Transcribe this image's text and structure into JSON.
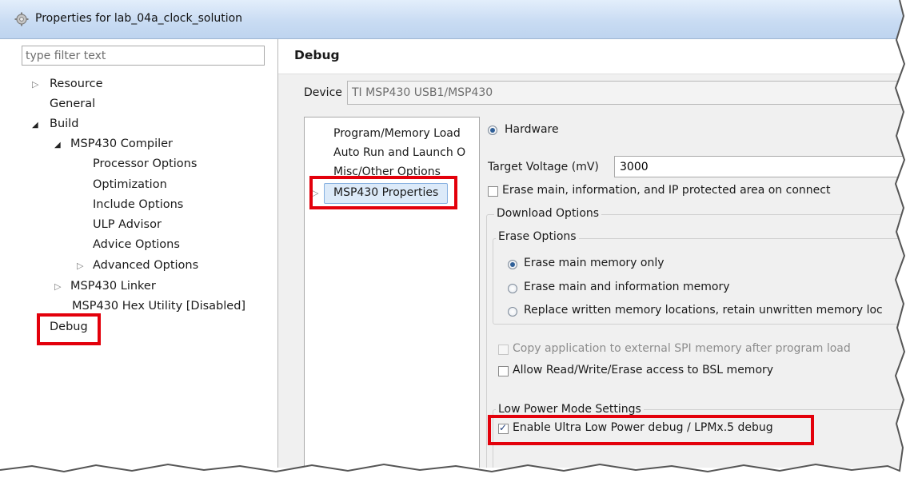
{
  "window": {
    "title": "Properties for lab_04a_clock_solution"
  },
  "left_pane": {
    "filter_placeholder": "type filter text",
    "tree": {
      "resource": "Resource",
      "general": "General",
      "build": "Build",
      "compiler": "MSP430 Compiler",
      "processor_options": "Processor Options",
      "optimization": "Optimization",
      "include_options": "Include Options",
      "ulp_advisor": "ULP Advisor",
      "advice_options": "Advice Options",
      "advanced_options": "Advanced Options",
      "linker": "MSP430 Linker",
      "hex_utility": "MSP430 Hex Utility  [Disabled]",
      "debug": "Debug"
    }
  },
  "right_pane": {
    "heading": "Debug",
    "device_label": "Device",
    "device_value": "TI MSP430 USB1/MSP430",
    "categories": {
      "program_memory_load": "Program/Memory Load",
      "auto_run": "Auto Run and Launch O",
      "misc_other": "Misc/Other Options",
      "msp430_properties": "MSP430 Properties"
    },
    "settings": {
      "hardware": "Hardware",
      "target_voltage_label": "Target Voltage (mV)",
      "target_voltage_value": "3000",
      "erase_on_connect": "Erase main, information, and IP protected area on connect",
      "download_options": "Download Options",
      "erase_options": "Erase Options",
      "erase_main_only": "Erase main memory only",
      "erase_main_info": "Erase main and information memory",
      "replace_written": "Replace written memory locations, retain unwritten memory loc",
      "copy_spi": "Copy application to external SPI memory after program load",
      "allow_bsl": "Allow Read/Write/Erase access to BSL memory",
      "low_power_title": "Low Power Mode Settings",
      "enable_ulp_debug": "Enable Ultra Low Power debug / LPMx.5 debug"
    },
    "states": {
      "hardware_selected": true,
      "erase_on_connect": false,
      "erase_mode": "main_only",
      "copy_spi": false,
      "allow_bsl": false,
      "enable_ulp_debug": true
    }
  },
  "colors": {
    "highlight_box": "#e3000b",
    "title_bar": "#c9dcf3",
    "selection": "#dceaf9"
  },
  "icons": {
    "window": "gear-icon",
    "collapsed": "triangle-right-icon",
    "expanded": "triangle-down-icon"
  }
}
